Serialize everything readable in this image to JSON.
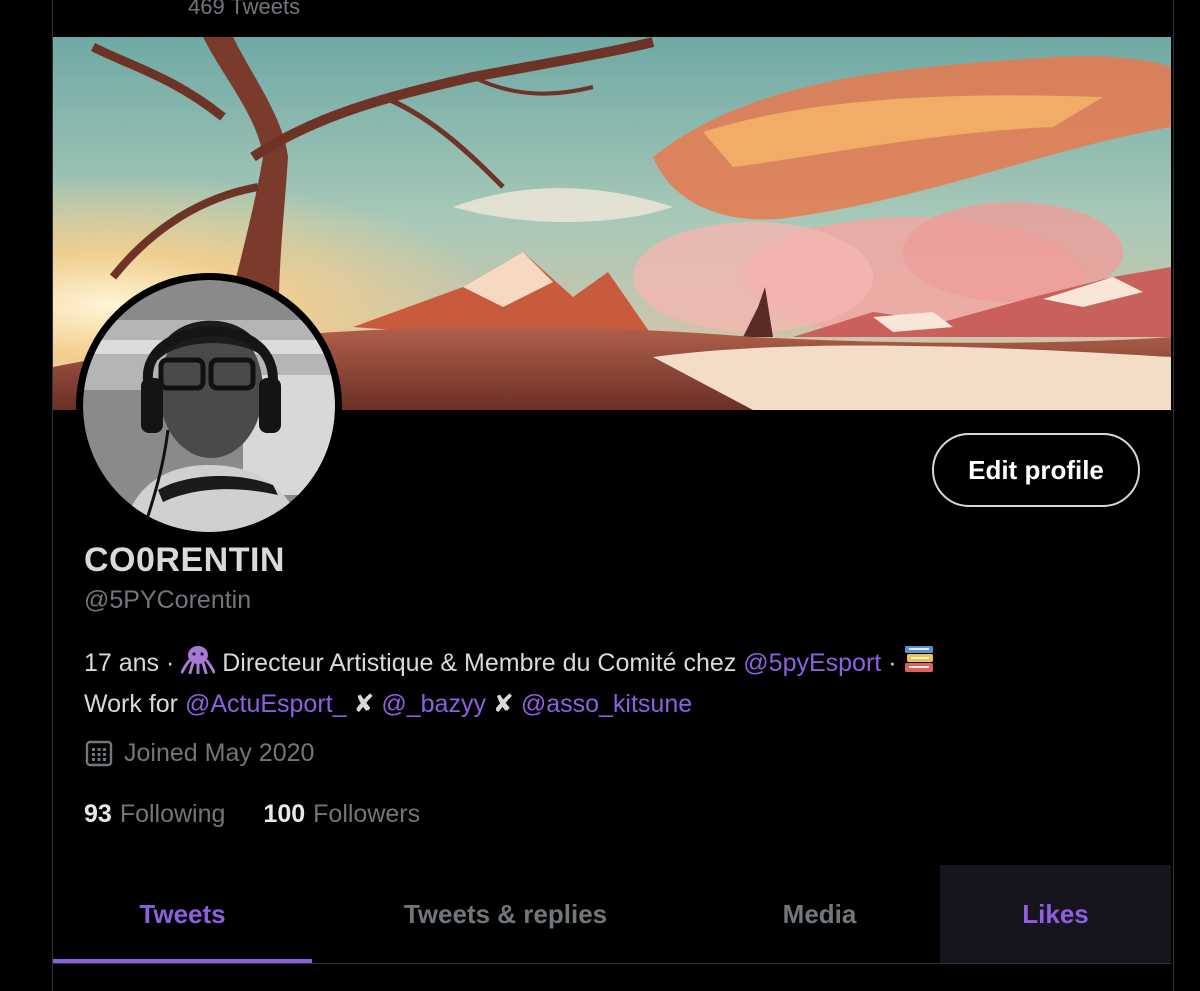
{
  "header": {
    "tweet_count": "469 Tweets"
  },
  "profile": {
    "display_name": "CO0RENTIN",
    "handle": "@5PYCorentin",
    "edit_label": "Edit profile",
    "bio": {
      "age": "17 ans",
      "dot": "·",
      "role": "Directeur Artistique & Membre du Comité chez",
      "org_mention": "@5pyEsport",
      "work_prefix": "Work for",
      "mention_1": "@ActuEsport_",
      "cross": "✘",
      "mention_2": "@_bazyy",
      "mention_3": "@asso_kitsune"
    },
    "joined": "Joined May 2020",
    "following_count": "93",
    "following_label": "Following",
    "followers_count": "100",
    "followers_label": "Followers"
  },
  "tabs": [
    {
      "label": "Tweets",
      "active": true
    },
    {
      "label": "Tweets & replies",
      "active": false
    },
    {
      "label": "Media",
      "active": false
    },
    {
      "label": "Likes",
      "active": false
    }
  ],
  "colors": {
    "accent": "#8e5fe0",
    "muted": "#71767b",
    "background": "#000000"
  },
  "icons": {
    "bio_1": "octopus-icon",
    "bio_2": "books-icon",
    "joined": "calendar-icon"
  }
}
